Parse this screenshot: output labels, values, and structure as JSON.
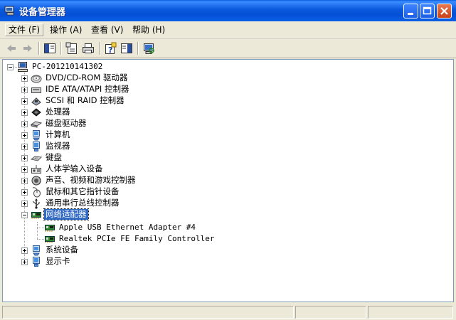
{
  "window": {
    "title": "设备管理器",
    "icon": "device-manager-icon",
    "controls": [
      "minimize-icon",
      "maximize-icon",
      "close-icon"
    ]
  },
  "menu": {
    "items": [
      {
        "label": "文件 (F)"
      },
      {
        "label": "操作 (A)"
      },
      {
        "label": "查看 (V)"
      },
      {
        "label": "帮助 (H)"
      }
    ]
  },
  "toolbar": {
    "icons": [
      "back-arrow-icon",
      "forward-arrow-icon",
      "show-hide-console-tree-icon",
      "properties-icon",
      "print-icon",
      "help-icon",
      "show-hide-action-pane-icon",
      "scan-hardware-icon"
    ]
  },
  "tree": {
    "root": {
      "label": "PC-201210141302",
      "icon": "computer-icon",
      "expanded": true
    },
    "categories": [
      {
        "label": "DVD/CD-ROM 驱动器",
        "icon": "cdrom-icon",
        "expanded": false
      },
      {
        "label": "IDE ATA/ATAPI 控制器",
        "icon": "ide-controller-icon",
        "expanded": false
      },
      {
        "label": "SCSI 和 RAID 控制器",
        "icon": "scsi-controller-icon",
        "expanded": false
      },
      {
        "label": "处理器",
        "icon": "processor-icon",
        "expanded": false
      },
      {
        "label": "磁盘驱动器",
        "icon": "disk-drive-icon",
        "expanded": false
      },
      {
        "label": "计算机",
        "icon": "computer-small-icon",
        "expanded": false
      },
      {
        "label": "监视器",
        "icon": "monitor-icon",
        "expanded": false
      },
      {
        "label": "键盘",
        "icon": "keyboard-icon",
        "expanded": false
      },
      {
        "label": "人体学输入设备",
        "icon": "hid-icon",
        "expanded": false
      },
      {
        "label": "声音、视频和游戏控制器",
        "icon": "sound-icon",
        "expanded": false
      },
      {
        "label": "鼠标和其它指针设备",
        "icon": "mouse-icon",
        "expanded": false
      },
      {
        "label": "通用串行总线控制器",
        "icon": "usb-icon",
        "expanded": false
      },
      {
        "label": "网络适配器",
        "icon": "network-adapter-icon",
        "expanded": true,
        "selected": true,
        "children": [
          {
            "label": "Apple USB Ethernet Adapter  #4",
            "icon": "network-card-icon"
          },
          {
            "label": "Realtek PCIe FE Family Controller",
            "icon": "network-card-icon"
          }
        ]
      },
      {
        "label": "系统设备",
        "icon": "system-device-icon",
        "expanded": false
      },
      {
        "label": "显示卡",
        "icon": "display-adapter-icon",
        "expanded": false
      }
    ]
  },
  "colors": {
    "titlebar": "#0a58dd",
    "selection": "#316ac5",
    "window_bg": "#ece9d8"
  }
}
